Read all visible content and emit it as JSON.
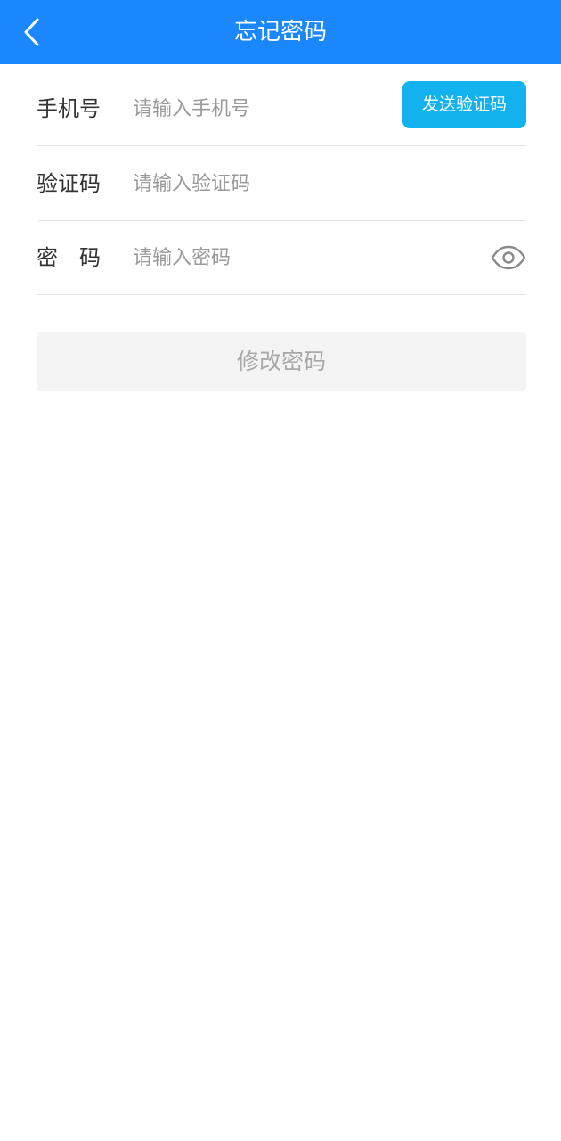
{
  "header": {
    "title": "忘记密码",
    "back_icon": "chevron-left-icon",
    "background_color": "#1a87ff"
  },
  "form": {
    "phone": {
      "label": "手机号",
      "placeholder": "请输入手机号",
      "value": "",
      "send_code_label": "发送验证码"
    },
    "code": {
      "label": "验证码",
      "placeholder": "请输入验证码",
      "value": ""
    },
    "password": {
      "label": "密　码",
      "placeholder": "请输入密码",
      "value": "",
      "visibility_icon": "eye-icon"
    }
  },
  "submit": {
    "label": "修改密码",
    "enabled": false
  },
  "colors": {
    "accent": "#1a87ff",
    "send_button": "#12b2ee",
    "disabled_button_bg": "#f4f4f4",
    "disabled_button_text": "#a8a8a8"
  }
}
